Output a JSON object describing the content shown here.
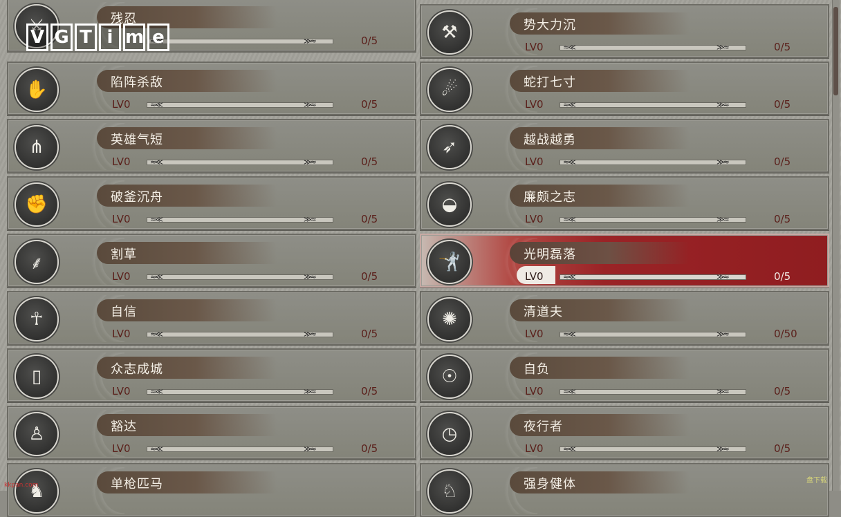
{
  "watermark": {
    "logo_letters": [
      "V",
      "G",
      "T",
      "i",
      "m",
      "e"
    ],
    "site_left": "kkpan.com",
    "site_right": "盘下载"
  },
  "left_skills": [
    {
      "name": "残忍",
      "level": "",
      "progress": "0/5",
      "icon": "blade-icon"
    },
    {
      "name": "陷阵杀敌",
      "level": "LV0",
      "progress": "0/5",
      "icon": "spear-icon"
    },
    {
      "name": "英雄气短",
      "level": "LV0",
      "progress": "0/5",
      "icon": "quiver-icon"
    },
    {
      "name": "破釜沉舟",
      "level": "LV0",
      "progress": "0/5",
      "icon": "axe-hand-icon"
    },
    {
      "name": "割草",
      "level": "LV0",
      "progress": "0/5",
      "icon": "grass-icon"
    },
    {
      "name": "自信",
      "level": "LV0",
      "progress": "0/5",
      "icon": "flex-icon"
    },
    {
      "name": "众志成城",
      "level": "LV0",
      "progress": "0/5",
      "icon": "shield-icon"
    },
    {
      "name": "豁达",
      "level": "LV0",
      "progress": "0/5",
      "icon": "kneel-icon"
    },
    {
      "name": "单枪匹马",
      "level": "",
      "progress": "",
      "icon": "rider-icon"
    }
  ],
  "right_skills": [
    {
      "name": "势大力沉",
      "level": "LV0",
      "progress": "0/5",
      "icon": "hammer-icon"
    },
    {
      "name": "蛇打七寸",
      "level": "LV0",
      "progress": "0/5",
      "icon": "strike-icon"
    },
    {
      "name": "越战越勇",
      "level": "LV0",
      "progress": "0/5",
      "icon": "archer-icon"
    },
    {
      "name": "廉颇之志",
      "level": "LV0",
      "progress": "0/5",
      "icon": "bowl-icon"
    },
    {
      "name": "光明磊落",
      "level": "LV0",
      "progress": "0/5",
      "icon": "lunge-icon",
      "active": true
    },
    {
      "name": "清道夫",
      "level": "LV0",
      "progress": "0/50",
      "icon": "loot-icon"
    },
    {
      "name": "自负",
      "level": "LV0",
      "progress": "0/5",
      "icon": "guard-icon"
    },
    {
      "name": "夜行者",
      "level": "LV0",
      "progress": "0/5",
      "icon": "clock-icon"
    },
    {
      "name": "强身健体",
      "level": "",
      "progress": "",
      "icon": "body-icon"
    }
  ]
}
